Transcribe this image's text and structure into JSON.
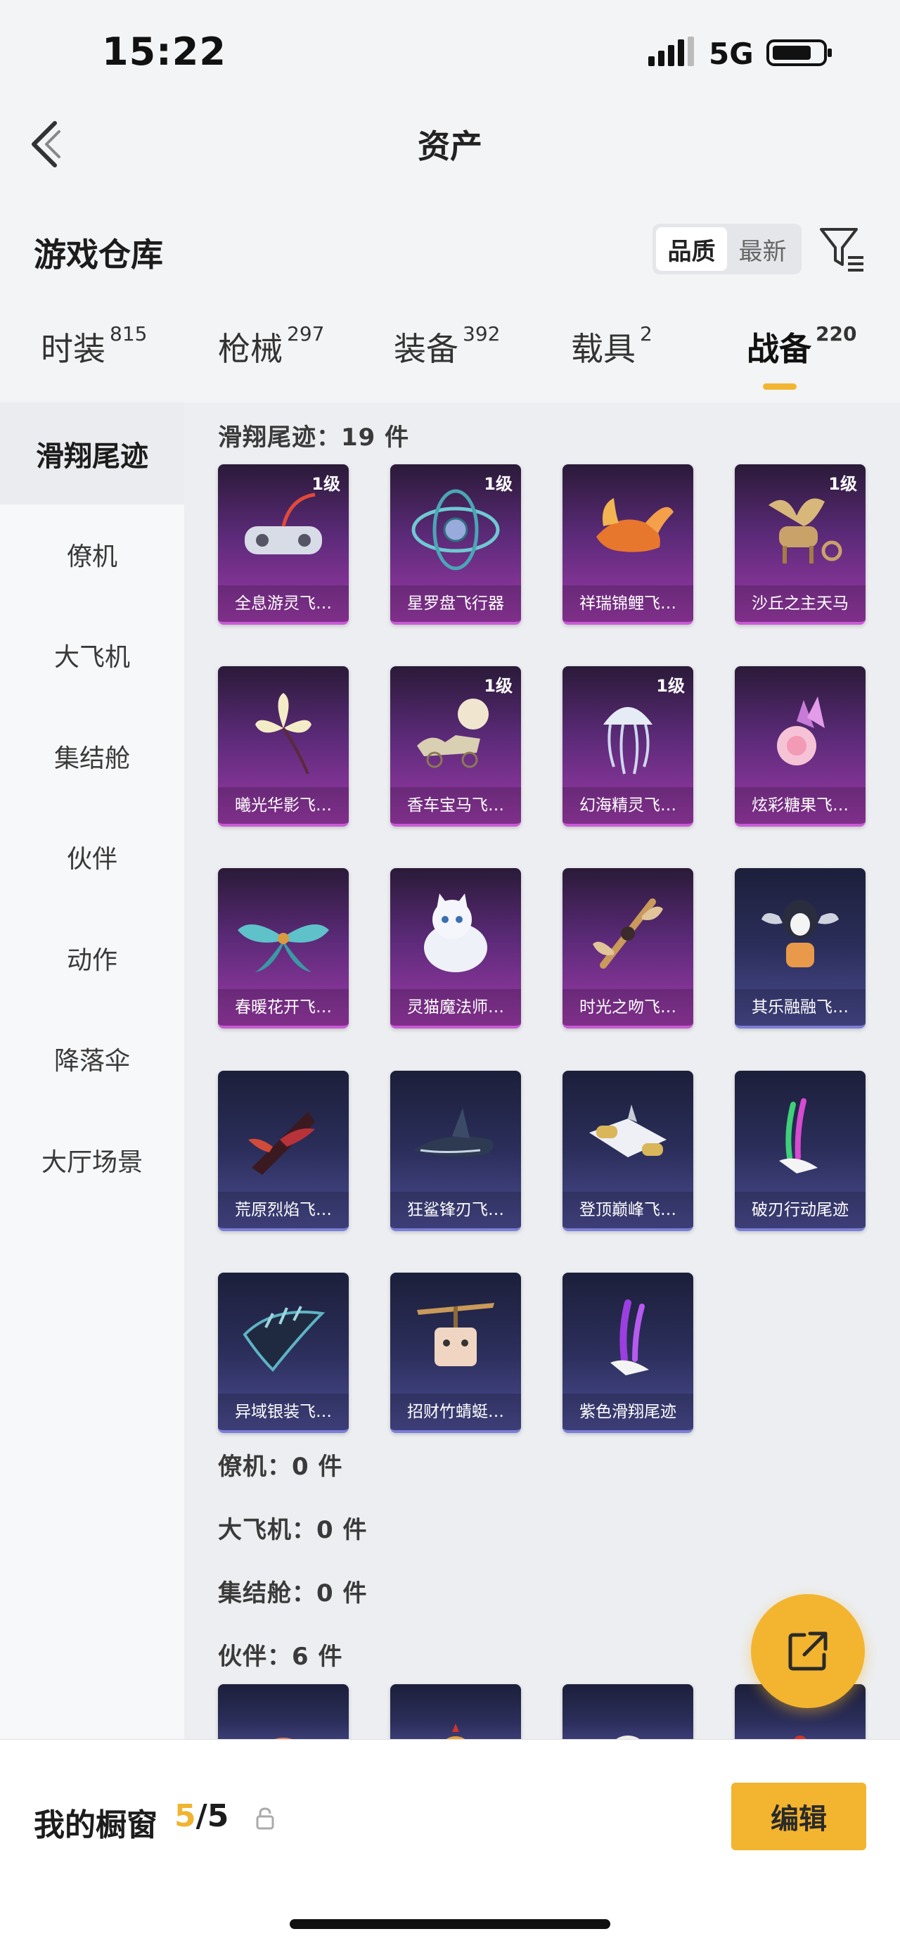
{
  "status_bar": {
    "time": "15:22",
    "network": "5G"
  },
  "header": {
    "title": "资产"
  },
  "warehouse": {
    "title": "游戏仓库",
    "sort_options": [
      "品质",
      "最新"
    ],
    "active_sort": "品质"
  },
  "category_tabs": [
    {
      "label": "时装",
      "count": "815"
    },
    {
      "label": "枪械",
      "count": "297"
    },
    {
      "label": "装备",
      "count": "392"
    },
    {
      "label": "载具",
      "count": "2"
    },
    {
      "label": "战备",
      "count": "220",
      "active": true
    }
  ],
  "sidebar": {
    "items": [
      {
        "label": "滑翔尾迹",
        "active": true
      },
      {
        "label": "僚机"
      },
      {
        "label": "大飞机"
      },
      {
        "label": "集结舱"
      },
      {
        "label": "伙伴"
      },
      {
        "label": "动作"
      },
      {
        "label": "降落伞"
      },
      {
        "label": "大厅场景"
      }
    ]
  },
  "sections": {
    "glide_trail": {
      "title": "滑翔尾迹：19 件"
    },
    "wingman": {
      "title": "僚机：0 件"
    },
    "big_plane": {
      "title": "大飞机：0 件"
    },
    "assembly_pod": {
      "title": "集结舱：0 件"
    },
    "partner": {
      "title": "伙伴：6 件"
    }
  },
  "items": [
    {
      "name": "全息游灵飞…",
      "level": "1级",
      "rarity": "purple",
      "icon": "hologram-glider-icon"
    },
    {
      "name": "星罗盘飞行器",
      "level": "1级",
      "rarity": "purple",
      "icon": "star-compass-icon"
    },
    {
      "name": "祥瑞锦鲤飞…",
      "level": "",
      "rarity": "purple",
      "icon": "koi-fish-icon"
    },
    {
      "name": "沙丘之主天马",
      "level": "1级",
      "rarity": "purple",
      "icon": "pegasus-icon"
    },
    {
      "name": "曦光华影飞…",
      "level": "",
      "rarity": "purple",
      "icon": "flower-icon"
    },
    {
      "name": "香车宝马飞…",
      "level": "1级",
      "rarity": "purple",
      "icon": "carriage-icon"
    },
    {
      "name": "幻海精灵飞…",
      "level": "1级",
      "rarity": "purple",
      "icon": "jellyfish-icon"
    },
    {
      "name": "炫彩糖果飞…",
      "level": "",
      "rarity": "purple",
      "icon": "candy-icon"
    },
    {
      "name": "春暖花开飞…",
      "level": "",
      "rarity": "purple",
      "icon": "butterfly-icon"
    },
    {
      "name": "灵猫魔法师…",
      "level": "",
      "rarity": "purple",
      "icon": "cat-icon"
    },
    {
      "name": "时光之吻飞…",
      "level": "",
      "rarity": "purple",
      "icon": "time-kiss-icon"
    },
    {
      "name": "其乐融融飞…",
      "level": "",
      "rarity": "blue",
      "icon": "penguin-icon"
    },
    {
      "name": "荒原烈焰飞…",
      "level": "",
      "rarity": "blue",
      "icon": "flame-glider-icon"
    },
    {
      "name": "狂鲨锋刃飞…",
      "level": "",
      "rarity": "blue",
      "icon": "shark-icon"
    },
    {
      "name": "登顶巅峰飞…",
      "level": "",
      "rarity": "blue",
      "icon": "jet-icon"
    },
    {
      "name": "破刃行动尾迹",
      "level": "",
      "rarity": "blue",
      "icon": "trail-icon"
    },
    {
      "name": "异域银装飞…",
      "level": "",
      "rarity": "blue",
      "icon": "silver-wing-icon"
    },
    {
      "name": "招财竹蜻蜓…",
      "level": "",
      "rarity": "blue",
      "icon": "bamboo-copter-icon"
    },
    {
      "name": "紫色滑翔尾迹",
      "level": "",
      "rarity": "blue",
      "icon": "purple-trail-icon"
    }
  ],
  "showcase": {
    "label": "我的橱窗",
    "current": "5",
    "total": "/5",
    "edit_label": "编辑"
  },
  "colors": {
    "accent": "#f3b42f",
    "purple_rarity": "#9c3aa8",
    "blue_rarity": "#4b4c92"
  }
}
